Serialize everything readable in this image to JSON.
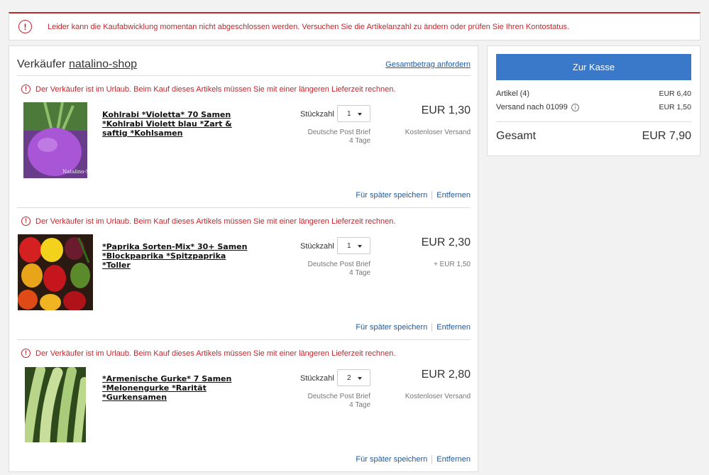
{
  "alert": {
    "text": "Leider kann die Kaufabwicklung momentan nicht abgeschlossen werden. Versuchen Sie die Artikelanzahl zu ändern oder prüfen Sie Ihren Kontostatus."
  },
  "seller": {
    "prefix": "Verkäufer ",
    "name": "natalino-shop",
    "request_total": "Gesamtbetrag anfordern"
  },
  "items": [
    {
      "warning": "Der Verkäufer ist im Urlaub. Beim Kauf dieses Artikels müssen Sie mit einer längeren Lieferzeit rechnen.",
      "title": "Kohlrabi *Violetta* 70 Samen *Kohlrabi Violett blau *Zart & saftig *Kohlsamen",
      "qty_label": "Stückzahl",
      "qty": "1",
      "shipping_method": "Deutsche Post Brief",
      "shipping_time": "4 Tage",
      "price": "EUR 1,30",
      "shipping_cost": "Kostenloser Versand",
      "save_later": "Für später speichern",
      "remove": "Entfernen"
    },
    {
      "warning": "Der Verkäufer ist im Urlaub. Beim Kauf dieses Artikels müssen Sie mit einer längeren Lieferzeit rechnen.",
      "title": "*Paprika Sorten-Mix* 30+ Samen *Blockpaprika *Spitzpaprika *Toller",
      "qty_label": "Stückzahl",
      "qty": "1",
      "shipping_method": "Deutsche Post Brief",
      "shipping_time": "4 Tage",
      "price": "EUR 2,30",
      "shipping_cost": "+ EUR 1,50",
      "save_later": "Für später speichern",
      "remove": "Entfernen"
    },
    {
      "warning": "Der Verkäufer ist im Urlaub. Beim Kauf dieses Artikels müssen Sie mit einer längeren Lieferzeit rechnen.",
      "title": "*Armenische Gurke* 7 Samen *Melonengurke *Rarität *Gurkensamen",
      "qty_label": "Stückzahl",
      "qty": "2",
      "shipping_method": "Deutsche Post Brief",
      "shipping_time": "4 Tage",
      "price": "EUR 2,80",
      "shipping_cost": "Kostenloser Versand",
      "save_later": "Für später speichern",
      "remove": "Entfernen"
    }
  ],
  "summary": {
    "checkout": "Zur Kasse",
    "items_label": "Artikel (4)",
    "items_value": "EUR 6,40",
    "shipping_label": "Versand nach 01099",
    "shipping_value": "EUR 1,50",
    "total_label": "Gesamt",
    "total_value": "EUR 7,90"
  },
  "colors": {
    "error": "#c0272d",
    "link": "#1e5aa0",
    "button": "#3a78c9"
  }
}
